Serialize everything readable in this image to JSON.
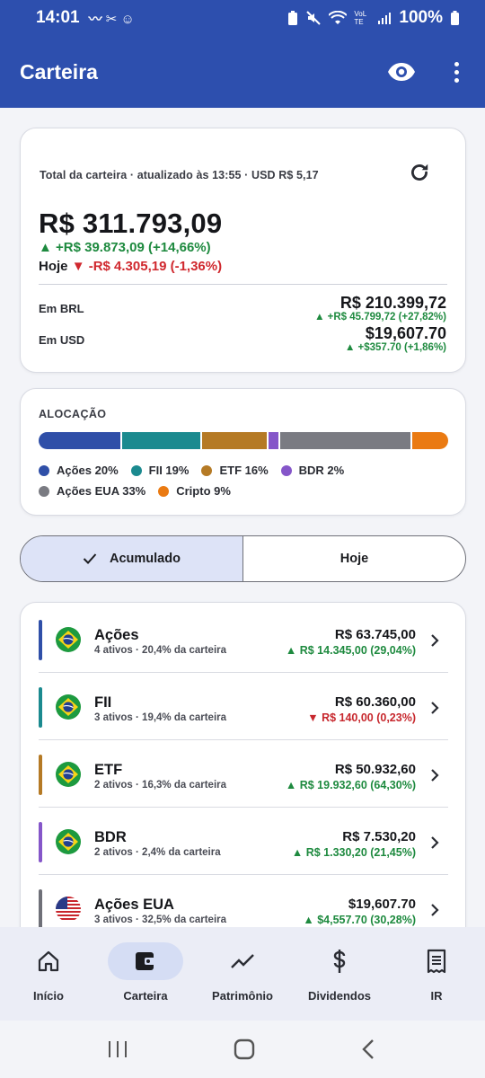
{
  "status_bar": {
    "time": "14:01",
    "battery": "100%",
    "network": "VoLTE"
  },
  "app_bar": {
    "title": "Carteira"
  },
  "total": {
    "header": "Total da carteira  ·  atualizado às 13:55  ·  USD R$ 5,17",
    "value": "R$ 311.793,09",
    "gain": "▲ +R$ 39.873,09 (+14,66%)",
    "today_label": "Hoje",
    "today_change": "▼ -R$ 4.305,19 (-1,36%)",
    "brl": {
      "label": "Em BRL",
      "value": "R$ 210.399,72",
      "change": "▲ +R$ 45.799,72 (+27,82%)"
    },
    "usd": {
      "label": "Em USD",
      "value": "$19,607.70",
      "change": "▲ +$357.70 (+1,86%)"
    }
  },
  "allocation": {
    "title": "ALOCAÇÃO",
    "segments": [
      {
        "label": "Ações 20%",
        "share": 20.4,
        "color": "#2f4fa8"
      },
      {
        "label": "FII 19%",
        "share": 19.4,
        "color": "#1b8a8f"
      },
      {
        "label": "ETF 16%",
        "share": 16.3,
        "color": "#b57a25"
      },
      {
        "label": "BDR 2%",
        "share": 2.4,
        "color": "#8556c9"
      },
      {
        "label": "Ações EUA 33%",
        "share": 32.5,
        "color": "#7a7b82"
      },
      {
        "label": "Cripto 9%",
        "share": 9.0,
        "color": "#ea7a12"
      }
    ]
  },
  "toggle": {
    "accumulated": "Acumulado",
    "today": "Hoje"
  },
  "assets": [
    {
      "name": "Ações",
      "sub": "4 ativos · 20,4% da carteira",
      "value": "R$ 63.745,00",
      "change": "▲ R$ 14.345,00 (29,04%)",
      "trend": "pos",
      "color": "#2f4fa8",
      "flag": "br"
    },
    {
      "name": "FII",
      "sub": "3 ativos · 19,4% da carteira",
      "value": "R$ 60.360,00",
      "change": "▼ R$ 140,00 (0,23%)",
      "trend": "neg",
      "color": "#1b8a8f",
      "flag": "br"
    },
    {
      "name": "ETF",
      "sub": "2 ativos · 16,3% da carteira",
      "value": "R$ 50.932,60",
      "change": "▲ R$ 19.932,60 (64,30%)",
      "trend": "pos",
      "color": "#b57a25",
      "flag": "br"
    },
    {
      "name": "BDR",
      "sub": "2 ativos · 2,4% da carteira",
      "value": "R$ 7.530,20",
      "change": "▲ R$ 1.330,20 (21,45%)",
      "trend": "pos",
      "color": "#8556c9",
      "flag": "br"
    },
    {
      "name": "Ações EUA",
      "sub": "3 ativos · 32,5% da carteira",
      "value": "$19,607.70",
      "change": "▲ $4,557.70 (30,28%)",
      "trend": "pos",
      "color": "#6f7078",
      "flag": "us"
    }
  ],
  "bottom_nav": [
    {
      "label": "Início",
      "icon": "home-icon"
    },
    {
      "label": "Carteira",
      "icon": "wallet-icon",
      "active": true
    },
    {
      "label": "Patrimônio",
      "icon": "trend-icon"
    },
    {
      "label": "Dividendos",
      "icon": "dollar-icon"
    },
    {
      "label": "IR",
      "icon": "receipt-icon"
    }
  ]
}
